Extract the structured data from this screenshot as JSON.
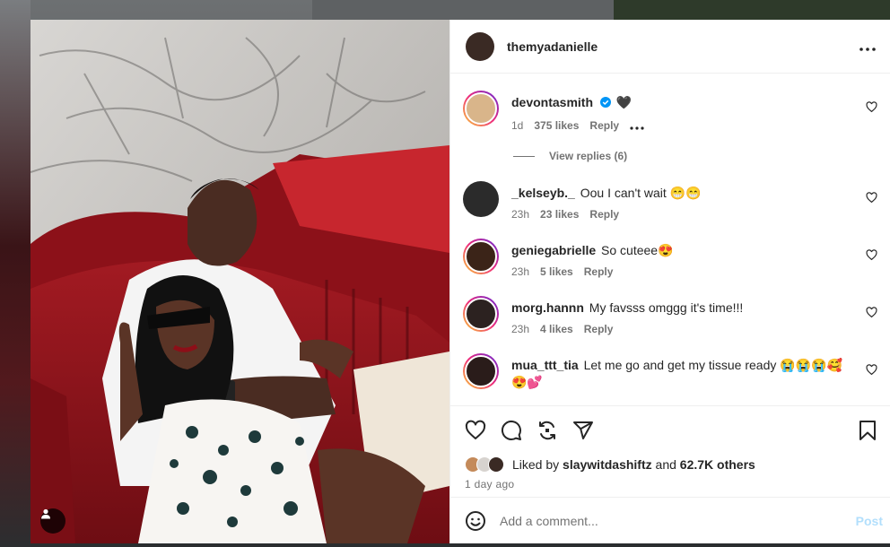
{
  "post": {
    "author": {
      "username": "themyadanielle",
      "avatar_color": "#3a2a24"
    },
    "more_icon": "more-horizontal-icon"
  },
  "comments": [
    {
      "username": "devontasmith",
      "verified": true,
      "text": "🖤",
      "time": "1d",
      "likes": "375 likes",
      "reply": "Reply",
      "avatar_color": "#d9b58a",
      "ring": true,
      "has_more": true,
      "view_replies": "View replies (6)"
    },
    {
      "username": "_kelseyb._",
      "text": "Oou I can't wait 😁😁",
      "time": "23h",
      "likes": "23 likes",
      "reply": "Reply",
      "avatar_color": "#2b2b2b",
      "ring": false
    },
    {
      "username": "geniegabrielle",
      "text": "So cuteee😍",
      "time": "23h",
      "likes": "5 likes",
      "reply": "Reply",
      "avatar_color": "#3b2418",
      "ring": true
    },
    {
      "username": "morg.hannn",
      "text": "My favsss omggg it's time!!!",
      "time": "23h",
      "likes": "4 likes",
      "reply": "Reply",
      "avatar_color": "#2c2220",
      "ring": true
    },
    {
      "username": "mua_ttt_tia",
      "text": "Let me go and get my tissue ready 😭😭😭🥰😍💕",
      "avatar_color": "#2a1c1a",
      "ring": true
    }
  ],
  "actions": {
    "like_icon": "heart-icon",
    "comment_icon": "comment-icon",
    "share_icon": "repost-icon",
    "send_icon": "send-icon",
    "save_icon": "bookmark-icon"
  },
  "likes": {
    "prefix": "Liked by",
    "user": "slaywitdashiftz",
    "middle": "and",
    "others": "62.7K others"
  },
  "date": "1 day ago",
  "add_comment": {
    "placeholder": "Add a comment...",
    "post_label": "Post",
    "emoji_icon": "smiley-icon"
  },
  "colors": {
    "accent_blue": "#0095f6",
    "post_disabled": "#b2dffc",
    "text": "#262626",
    "muted": "#737373"
  }
}
